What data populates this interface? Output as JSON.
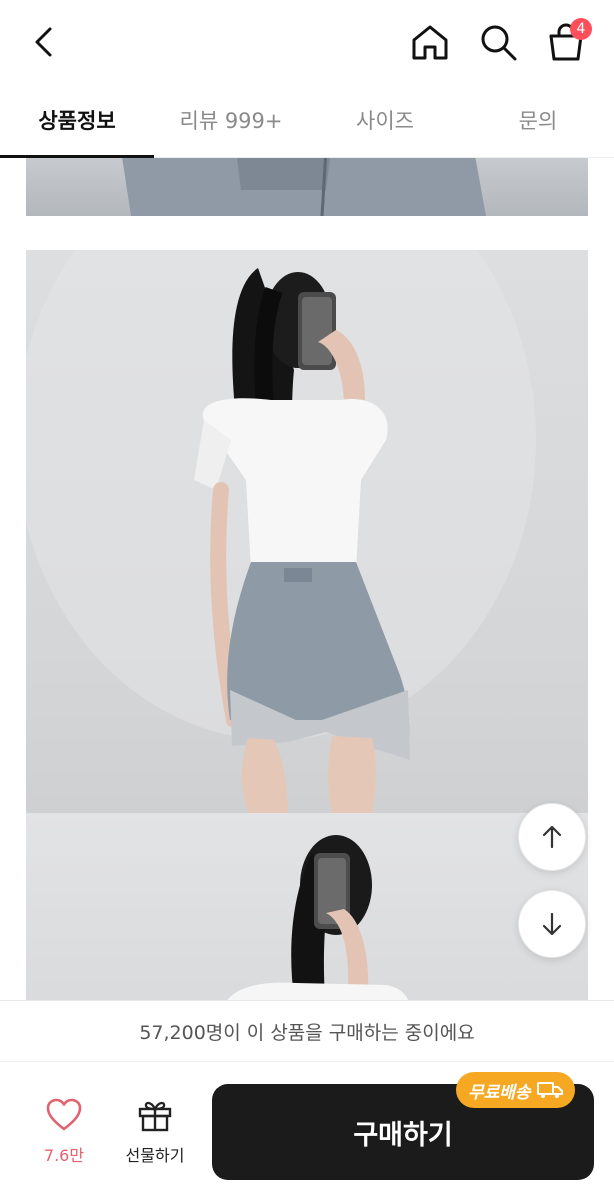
{
  "header": {
    "back_icon": "chevron-left-icon",
    "home_icon": "home-icon",
    "search_icon": "search-icon",
    "cart_icon": "shopping-bag-icon",
    "cart_count": "4",
    "badge_color": "#ff4f5a"
  },
  "tabs": [
    {
      "label": "상품정보",
      "active": true
    },
    {
      "label": "리뷰 999+",
      "active": false
    },
    {
      "label": "사이즈",
      "active": false
    },
    {
      "label": "문의",
      "active": false
    }
  ],
  "scroll_buttons": {
    "up_icon": "arrow-up-icon",
    "down_icon": "arrow-down-icon"
  },
  "notice": {
    "text": "57,200명이 이 상품을 구매하는 중이에요"
  },
  "bottom_bar": {
    "like_icon": "heart-icon",
    "like_count": "7.6만",
    "gift_icon": "gift-icon",
    "gift_label": "선물하기",
    "buy_label": "구매하기",
    "free_shipping_label": "무료배송",
    "free_shipping_icon": "truck-icon",
    "buy_color": "#1b1b1b",
    "badge_color": "#f6a823",
    "like_color": "#e0636e"
  }
}
